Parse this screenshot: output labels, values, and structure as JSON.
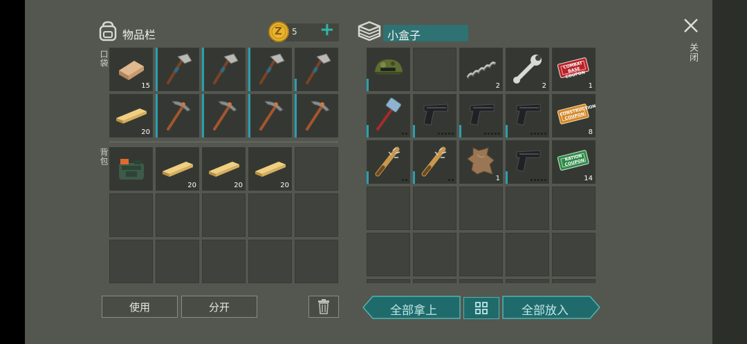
{
  "inventory": {
    "title": "物品栏",
    "pocket_label": "口袋",
    "backpack_label": "背包",
    "coins": "5",
    "coin_symbol": "Z",
    "add_label": "+",
    "pocket_slots": [
      {
        "icon": "wood-log-icon",
        "count": "15",
        "bar": "none"
      },
      {
        "icon": "hatchet-icon",
        "count": "",
        "bar": "full"
      },
      {
        "icon": "hatchet-icon",
        "count": "",
        "bar": "full"
      },
      {
        "icon": "hatchet-icon",
        "count": "",
        "bar": "full"
      },
      {
        "icon": "hatchet-icon",
        "count": "",
        "bar": "short"
      },
      {
        "icon": "wood-plank-icon",
        "count": "20",
        "bar": "none"
      },
      {
        "icon": "pickaxe-icon",
        "count": "",
        "bar": "full"
      },
      {
        "icon": "pickaxe-icon",
        "count": "",
        "bar": "full"
      },
      {
        "icon": "pickaxe-icon",
        "count": "",
        "bar": "full"
      },
      {
        "icon": "pickaxe-icon",
        "count": "",
        "bar": "full"
      }
    ],
    "backpack_slots": [
      {
        "icon": "backpack-bag-icon",
        "count": "",
        "bar": "none"
      },
      {
        "icon": "wood-plank-icon",
        "count": "20",
        "bar": "none"
      },
      {
        "icon": "wood-plank-icon",
        "count": "20",
        "bar": "none"
      },
      {
        "icon": "wood-plank-icon",
        "count": "20",
        "bar": "none"
      },
      {
        "icon": "",
        "count": "",
        "bar": "none"
      },
      {
        "icon": "",
        "count": "",
        "bar": "none"
      },
      {
        "icon": "",
        "count": "",
        "bar": "none"
      },
      {
        "icon": "",
        "count": "",
        "bar": "none"
      },
      {
        "icon": "",
        "count": "",
        "bar": "none"
      },
      {
        "icon": "",
        "count": "",
        "bar": "none"
      },
      {
        "icon": "",
        "count": "",
        "bar": "none"
      },
      {
        "icon": "",
        "count": "",
        "bar": "none"
      },
      {
        "icon": "",
        "count": "",
        "bar": "none"
      },
      {
        "icon": "",
        "count": "",
        "bar": "none"
      },
      {
        "icon": "",
        "count": "",
        "bar": "none"
      }
    ]
  },
  "container": {
    "title": "小盒子",
    "slots": [
      {
        "icon": "camo-cap-icon",
        "count": "",
        "bar": "short"
      },
      {
        "icon": "",
        "count": "",
        "bar": "none"
      },
      {
        "icon": "spring-icon",
        "count": "2",
        "bar": "none"
      },
      {
        "icon": "wrench-icon",
        "count": "2",
        "bar": "none"
      },
      {
        "icon": "red-coupon-icon",
        "count": "1",
        "bar": "none"
      },
      {
        "icon": "sledgehammer-icon",
        "count": "",
        "bar": "short",
        "dots": 2
      },
      {
        "icon": "pistol-icon",
        "count": "",
        "bar": "short",
        "dots": 5
      },
      {
        "icon": "pistol-icon",
        "count": "",
        "bar": "short",
        "dots": 5
      },
      {
        "icon": "pistol-icon",
        "count": "",
        "bar": "short",
        "dots": 5
      },
      {
        "icon": "orange-coupon-icon",
        "count": "8",
        "bar": "none"
      },
      {
        "icon": "spiked-bat-icon",
        "count": "",
        "bar": "short",
        "dots": 2
      },
      {
        "icon": "spiked-bat-icon",
        "count": "",
        "bar": "short",
        "dots": 2
      },
      {
        "icon": "hide-icon",
        "count": "1",
        "bar": "none"
      },
      {
        "icon": "pistol-icon",
        "count": "",
        "bar": "short",
        "dots": 5
      },
      {
        "icon": "green-coupon-icon",
        "count": "14",
        "bar": "none"
      },
      {
        "icon": "",
        "count": "",
        "bar": "none"
      },
      {
        "icon": "",
        "count": "",
        "bar": "none"
      },
      {
        "icon": "",
        "count": "",
        "bar": "none"
      },
      {
        "icon": "",
        "count": "",
        "bar": "none"
      },
      {
        "icon": "",
        "count": "",
        "bar": "none"
      },
      {
        "icon": "",
        "count": "",
        "bar": "none"
      },
      {
        "icon": "",
        "count": "",
        "bar": "none"
      },
      {
        "icon": "",
        "count": "",
        "bar": "none"
      },
      {
        "icon": "",
        "count": "",
        "bar": "none"
      },
      {
        "icon": "",
        "count": "",
        "bar": "none"
      },
      {
        "icon": "",
        "count": "",
        "bar": "none"
      },
      {
        "icon": "",
        "count": "",
        "bar": "none"
      },
      {
        "icon": "",
        "count": "",
        "bar": "none"
      },
      {
        "icon": "",
        "count": "",
        "bar": "none"
      },
      {
        "icon": "",
        "count": "",
        "bar": "none"
      }
    ]
  },
  "coupon_texts": {
    "red": [
      "COMBAT BASE",
      "COUPON"
    ],
    "orange": [
      "CONSTRUCTION",
      "COUPON"
    ],
    "green": [
      "RATION",
      "COUPON"
    ]
  },
  "buttons": {
    "use": "使用",
    "split": "分开",
    "take_all": "全部拿上",
    "put_all": "全部放入",
    "close": "关闭"
  },
  "colors": {
    "accent_teal": "#2b9fb0",
    "coin_gold": "#e7b531"
  }
}
